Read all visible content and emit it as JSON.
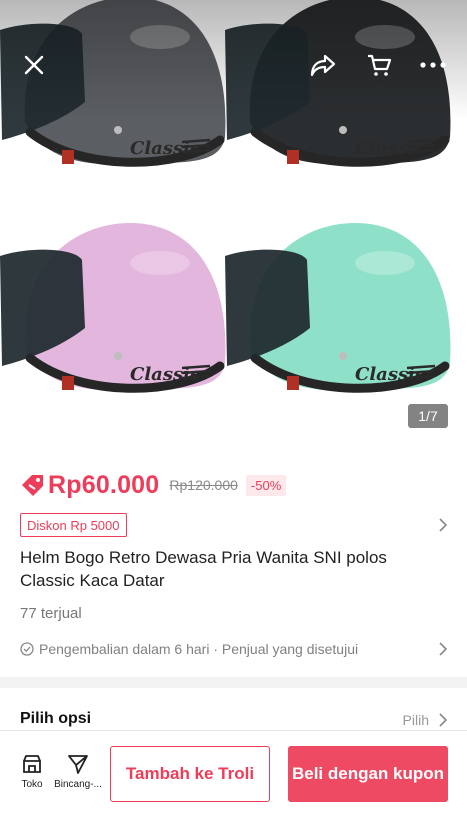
{
  "gallery": {
    "counter": "1/7",
    "helmet_colors": [
      "#5b5e62",
      "#2b2e30",
      "#e3b6dd",
      "#8fe0c9"
    ],
    "brand_script": "Classic",
    "icons": {
      "close": "close-icon",
      "share": "share-icon",
      "cart": "cart-icon",
      "more": "more-icon"
    }
  },
  "product": {
    "price": "Rp60.000",
    "old_price": "Rp120.000",
    "discount_pct": "-50%",
    "coupon": "Diskon Rp 5000",
    "title": "Helm Bogo Retro Dewasa Pria Wanita SNI polos Classic Kaca Datar",
    "sold": "77 terjual",
    "returns": "Pengembalian dalam 6 hari · Penjual yang disetujui"
  },
  "options": {
    "label": "Pilih opsi",
    "action": "Pilih"
  },
  "bottom_bar": {
    "shop_label": "Toko",
    "chat_label": "Bincang-...",
    "add_to_cart": "Tambah ke Troli",
    "buy_with_coupon": "Beli dengan kupon"
  },
  "colors": {
    "accent": "#ee3d5a",
    "buy_button": "#ee4a63"
  }
}
